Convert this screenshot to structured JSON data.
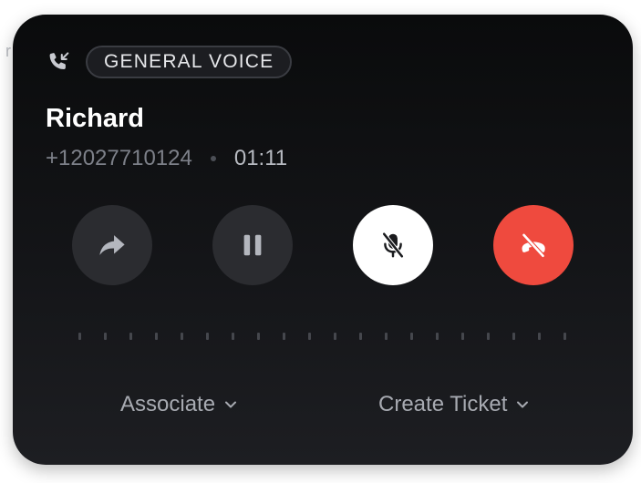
{
  "header": {
    "call_type_icon": "incoming-call-icon",
    "badge": "GENERAL VOICE"
  },
  "caller": {
    "name": "Richard",
    "phone": "+12027710124",
    "duration": "01:11"
  },
  "controls": [
    {
      "name": "forward",
      "icon": "forward-arrow-icon"
    },
    {
      "name": "hold",
      "icon": "pause-icon"
    },
    {
      "name": "mute",
      "icon": "mic-off-icon",
      "active": true
    },
    {
      "name": "hang-up",
      "icon": "phone-hangup-icon"
    }
  ],
  "actions": {
    "associate": "Associate",
    "create_ticket": "Create Ticket"
  },
  "colors": {
    "card_bg": "#0f1012",
    "hangup_red": "#ef4a3e",
    "button_dark": "#2b2c30"
  }
}
